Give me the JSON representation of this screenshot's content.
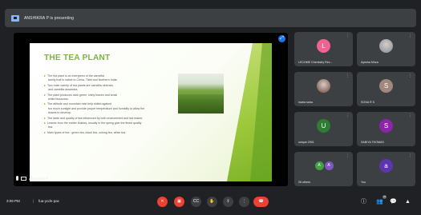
{
  "banner": {
    "text": "ANSHIKRA P is presenting"
  },
  "presenter": {
    "name": "ANSHIKRA P"
  },
  "slide": {
    "title": "THE TEA PLANT",
    "lines": [
      {
        "text": "The tea plant is an evergreen of the camellia",
        "bullet": true
      },
      {
        "text": "family that is native to China, Tibet and Northern India.",
        "bullet": false
      },
      {
        "text": "Two main variety of tea plants are camellia sinensis",
        "bullet": true
      },
      {
        "text": "and camellia assamica.",
        "bullet": false
      },
      {
        "text": "The plant produces dark green, shiny leaves and small",
        "bullet": true
      },
      {
        "text": "white blossoms.",
        "bullet": false
      },
      {
        "text": "The altitude and mountain mist help shield against",
        "bullet": true
      },
      {
        "text": "too much sunlight and provide proper temperature and humidity to allow the",
        "bullet": false
      },
      {
        "text": "leaves to develop.",
        "bullet": false
      },
      {
        "text": "The taste and quality of tea influenced by both environment and tea maker.",
        "bullet": true
      },
      {
        "text": "Leaves from the earlier flushes, usually in the spring give the finest quality",
        "bullet": true
      },
      {
        "text": "tea.",
        "bullet": false
      },
      {
        "text": "Main types of tea : green tea, black tea, oolong tea, white tea.",
        "bullet": true
      }
    ]
  },
  "participants": [
    {
      "initial": "L",
      "name": "LECHME Chemistry Rec...",
      "color": "#f06292",
      "type": "avatar"
    },
    {
      "initial": "",
      "name": "Ayesha Mirza",
      "color": "#9aa0a6",
      "type": "photo"
    },
    {
      "initial": "",
      "name": "maria saha",
      "color": "#8d6e63",
      "type": "photo"
    },
    {
      "initial": "S",
      "name": "SONA R S",
      "color": "#a1887f",
      "type": "avatar"
    },
    {
      "initial": "U",
      "name": "unique 2901",
      "color": "#2e7d32",
      "type": "avatar"
    },
    {
      "initial": "S",
      "name": "SABIYA THOMAS",
      "color": "#8e24aa",
      "type": "avatar"
    },
    {
      "initial": "A",
      "name": "26 others",
      "color": "#43a047",
      "type": "others"
    },
    {
      "initial": "a",
      "name": "You",
      "color": "#5e35b1",
      "type": "avatar"
    }
  ],
  "others_second_initial": "A",
  "bottom": {
    "time": "3:09 PM",
    "separator": "|",
    "meeting_code": "fua-ycdn-pac"
  },
  "participant_count": "31"
}
